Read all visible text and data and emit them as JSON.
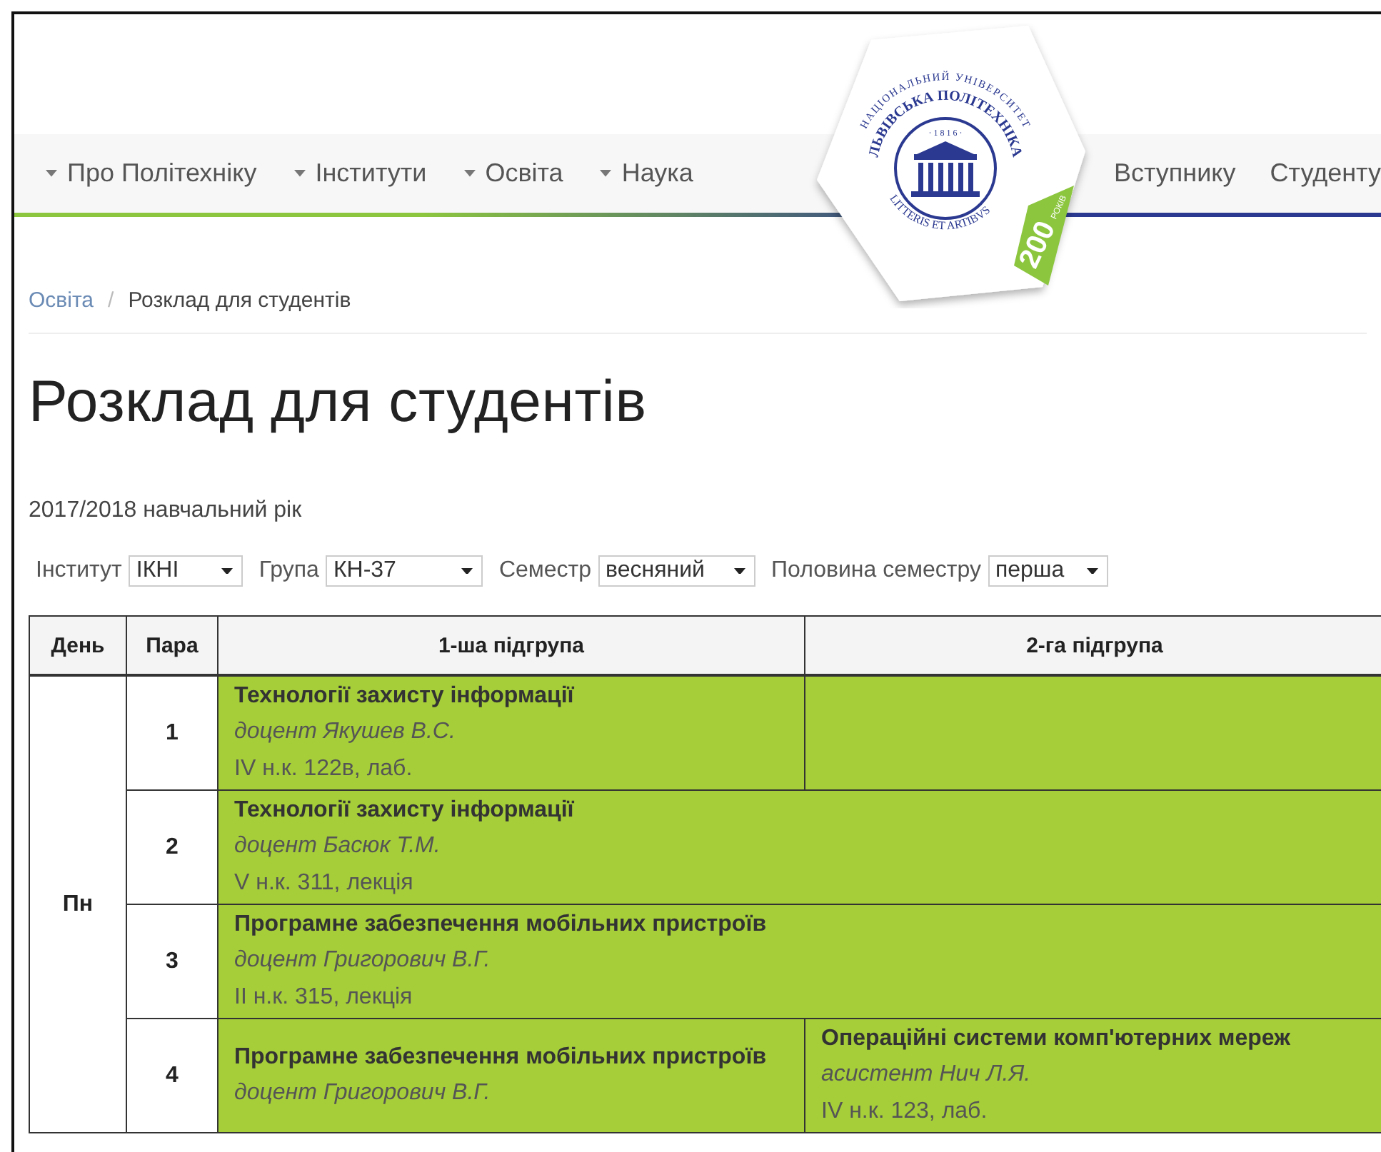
{
  "logo": {
    "top_arc": "НАЦІОНАЛЬНИЙ УНІВЕРСИТЕТ",
    "name_arc": "ЛЬВІВСЬКА ПОЛІТЕХНІКА",
    "year": "· 1 8 1 6 ·",
    "motto": "LITTERIS ET ARTIBVS",
    "anniversary": "200",
    "years_word": "РОКІВ"
  },
  "nav_left": [
    {
      "label": "Про Політехніку"
    },
    {
      "label": "Інститути"
    },
    {
      "label": "Освіта"
    },
    {
      "label": "Наука"
    }
  ],
  "nav_right": [
    {
      "label": "Вступнику"
    },
    {
      "label": "Студенту"
    }
  ],
  "breadcrumb": {
    "parent": "Освіта",
    "separator": "/",
    "current": "Розклад для студентів"
  },
  "title": "Розклад для студентів",
  "academic_year": "2017/2018 навчальний рік",
  "filters": [
    {
      "label": "Інститут",
      "value": "ІКНІ"
    },
    {
      "label": "Група",
      "value": "КН-37"
    },
    {
      "label": "Семестр",
      "value": "весняний"
    },
    {
      "label": "Половина семестру",
      "value": "перша"
    }
  ],
  "table": {
    "columns": [
      "День",
      "Пара",
      "1-ша підгрупа",
      "2-га підгрупа"
    ],
    "days": [
      {
        "day": "Пн",
        "pairs": [
          {
            "number": "1",
            "kind": "split",
            "subgroup_1": {
              "subject": "Технології захисту інформації",
              "teacher": "доцент Якушев В.С.",
              "room": "IV н.к. 122в, лаб."
            }
          },
          {
            "number": "2",
            "kind": "joint",
            "both": {
              "subject": "Технології захисту інформації",
              "teacher": "доцент Басюк Т.М.",
              "room": "V н.к. 311, лекція"
            }
          },
          {
            "number": "3",
            "kind": "joint",
            "both": {
              "subject": "Програмне забезпечення мобільних пристроїв",
              "teacher": "доцент Григорович В.Г.",
              "room": "II н.к. 315, лекція"
            }
          },
          {
            "number": "4",
            "kind": "split",
            "subgroup_1": {
              "subject": "Програмне забезпечення мобільних пристроїв",
              "teacher": "доцент Григорович В.Г."
            },
            "subgroup_2": {
              "subject": "Операційні системи комп'ютерних мереж",
              "teacher": "асистент Нич Л.Я.",
              "room": "IV н.к. 123, лаб."
            }
          }
        ]
      }
    ]
  }
}
